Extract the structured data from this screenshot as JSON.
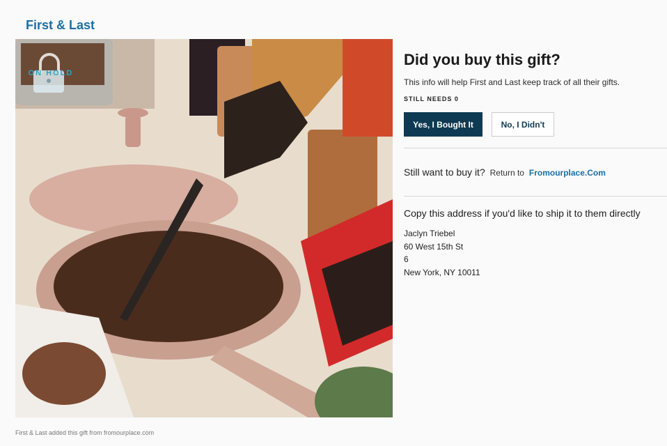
{
  "brand": {
    "title": "First & Last"
  },
  "product_image": {
    "badge": "ON HOLD",
    "lock_icon": "lock-icon"
  },
  "panel": {
    "title": "Did you buy this gift?",
    "subtitle": "This info will help First and Last keep track of all their gifts.",
    "still_needs": "STILL NEEDS 0",
    "yes_label": "Yes, I Bought It",
    "no_label": "No, I Didn't",
    "buy_prompt": "Still want to buy it?",
    "return_to": "Return to",
    "store_link": "Fromourplace.Com",
    "copy_title": "Copy this address if you'd like to ship it to them directly",
    "address": [
      "Jaclyn Triebel",
      "60 West 15th St",
      "6",
      "New York, NY 10011"
    ]
  },
  "colors": {
    "brand": "#1a6fa3",
    "primary_button": "#0f3a53",
    "badge": "#2aa6c4"
  },
  "footer": {
    "note": "First & Last added this gift from fromourplace.com"
  }
}
